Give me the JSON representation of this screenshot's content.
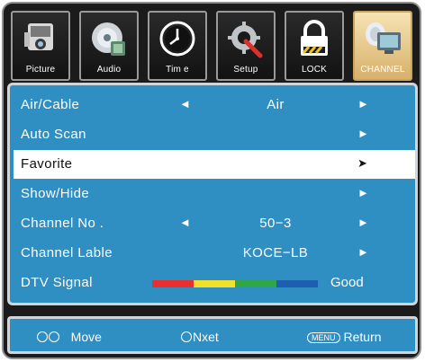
{
  "tabs": [
    {
      "label": "Picture",
      "icon": "camera-icon"
    },
    {
      "label": "Audio",
      "icon": "disc-icon"
    },
    {
      "label": "Tim e",
      "icon": "clock-icon"
    },
    {
      "label": "Setup",
      "icon": "tools-icon"
    },
    {
      "label": "LOCK",
      "icon": "lock-icon"
    },
    {
      "label": "CHANNEL",
      "icon": "monitor-dish-icon"
    }
  ],
  "active_tab": "CHANNEL",
  "menu": {
    "rows": [
      {
        "label": "Air/Cable",
        "value": "Air",
        "left_arrow": "◄",
        "right_arrow": "►"
      },
      {
        "label": "Auto Scan",
        "right_arrow": "►"
      },
      {
        "label": "Favorite",
        "right_arrow": "➤"
      },
      {
        "label": "Show/Hide",
        "right_arrow": "►"
      },
      {
        "label": "Channel No .",
        "value": "50−3",
        "left_arrow": "◄",
        "right_arrow": "►"
      },
      {
        "label": "Channel Lable",
        "value": "KOCE−LB",
        "right_arrow": "►"
      },
      {
        "label": "DTV Signal",
        "signal_text": "Good",
        "signal_colors": [
          "#e8312e",
          "#f2e12a",
          "#2fa64a",
          "#1c5fb0"
        ]
      }
    ]
  },
  "help": {
    "move": "Move",
    "next": "Nxet",
    "menu_key": "MENU",
    "return": "Return"
  },
  "colors": {
    "panel": "#2f8ec2",
    "selected_row": "#ffffff",
    "active_tab": "#e7c98a"
  }
}
